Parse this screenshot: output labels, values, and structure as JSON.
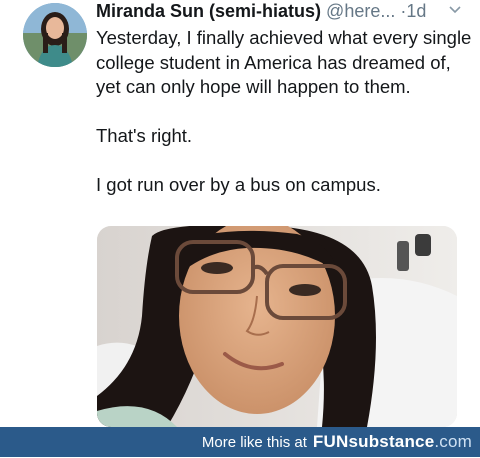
{
  "tweet": {
    "display_name": "Miranda Sun (semi-hiatus)",
    "handle": "@here...",
    "separator": "·",
    "time": "1d",
    "avatar_icon": "profile-photo",
    "menu_icon": "chevron-down-icon",
    "paragraphs": [
      "Yesterday, I finally achieved what every single college student in America has dreamed of, yet can only hope will happen to them.",
      "That's right.",
      "I got run over by a bus on campus."
    ],
    "photo_description_icon": "hospital-selfie-photo"
  },
  "footer": {
    "more_text": "More like this at",
    "brand_part1": "FUN",
    "brand_part2": "substance",
    "brand_part3": ".com",
    "background": "#2b5a8a"
  }
}
